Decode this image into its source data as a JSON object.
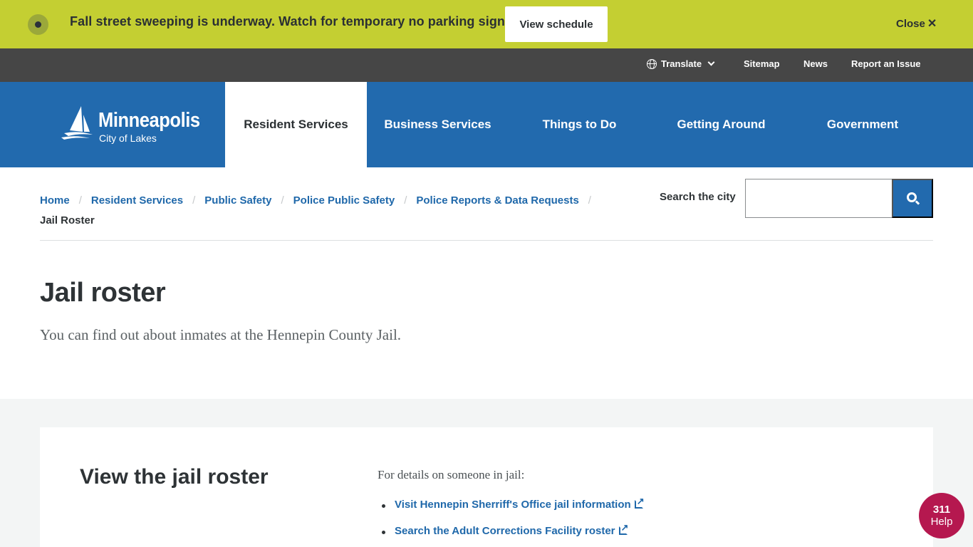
{
  "alert": {
    "message": "Fall street sweeping is underway. Watch for temporary no parking signs.",
    "button_label": "View schedule",
    "close_label": "Close",
    "close_icon": "close-x-icon",
    "bg_color": "#c4cf32"
  },
  "utility_nav": {
    "translate_label": "Translate",
    "translate_icon": "globe-icon",
    "items": [
      "Sitemap",
      "News",
      "Report an Issue"
    ]
  },
  "logo": {
    "name": "Minneapolis",
    "tagline": "City of Lakes"
  },
  "main_nav": {
    "items": [
      {
        "label": "Resident Services",
        "active": true
      },
      {
        "label": "Business Services",
        "active": false
      },
      {
        "label": "Things to Do",
        "active": false
      },
      {
        "label": "Getting Around",
        "active": false
      },
      {
        "label": "Government",
        "active": false
      }
    ],
    "brand_color": "#226aae"
  },
  "breadcrumb": {
    "links": [
      "Home",
      "Resident Services",
      "Public Safety",
      "Police Public Safety",
      "Police Reports & Data Requests"
    ],
    "separator": "/",
    "current": "Jail Roster"
  },
  "search": {
    "label": "Search the city",
    "value": "",
    "placeholder": ""
  },
  "page": {
    "title": "Jail roster",
    "lead": "You can find out about inmates at the Hennepin County Jail."
  },
  "card": {
    "title": "View the jail roster",
    "intro": "For details on someone in jail:",
    "links": [
      "Visit Hennepin Sherriff's Office jail information",
      "Search the Adult Corrections Facility roster"
    ]
  },
  "help": {
    "number": "311",
    "label": "Help",
    "color": "#b5184f"
  }
}
